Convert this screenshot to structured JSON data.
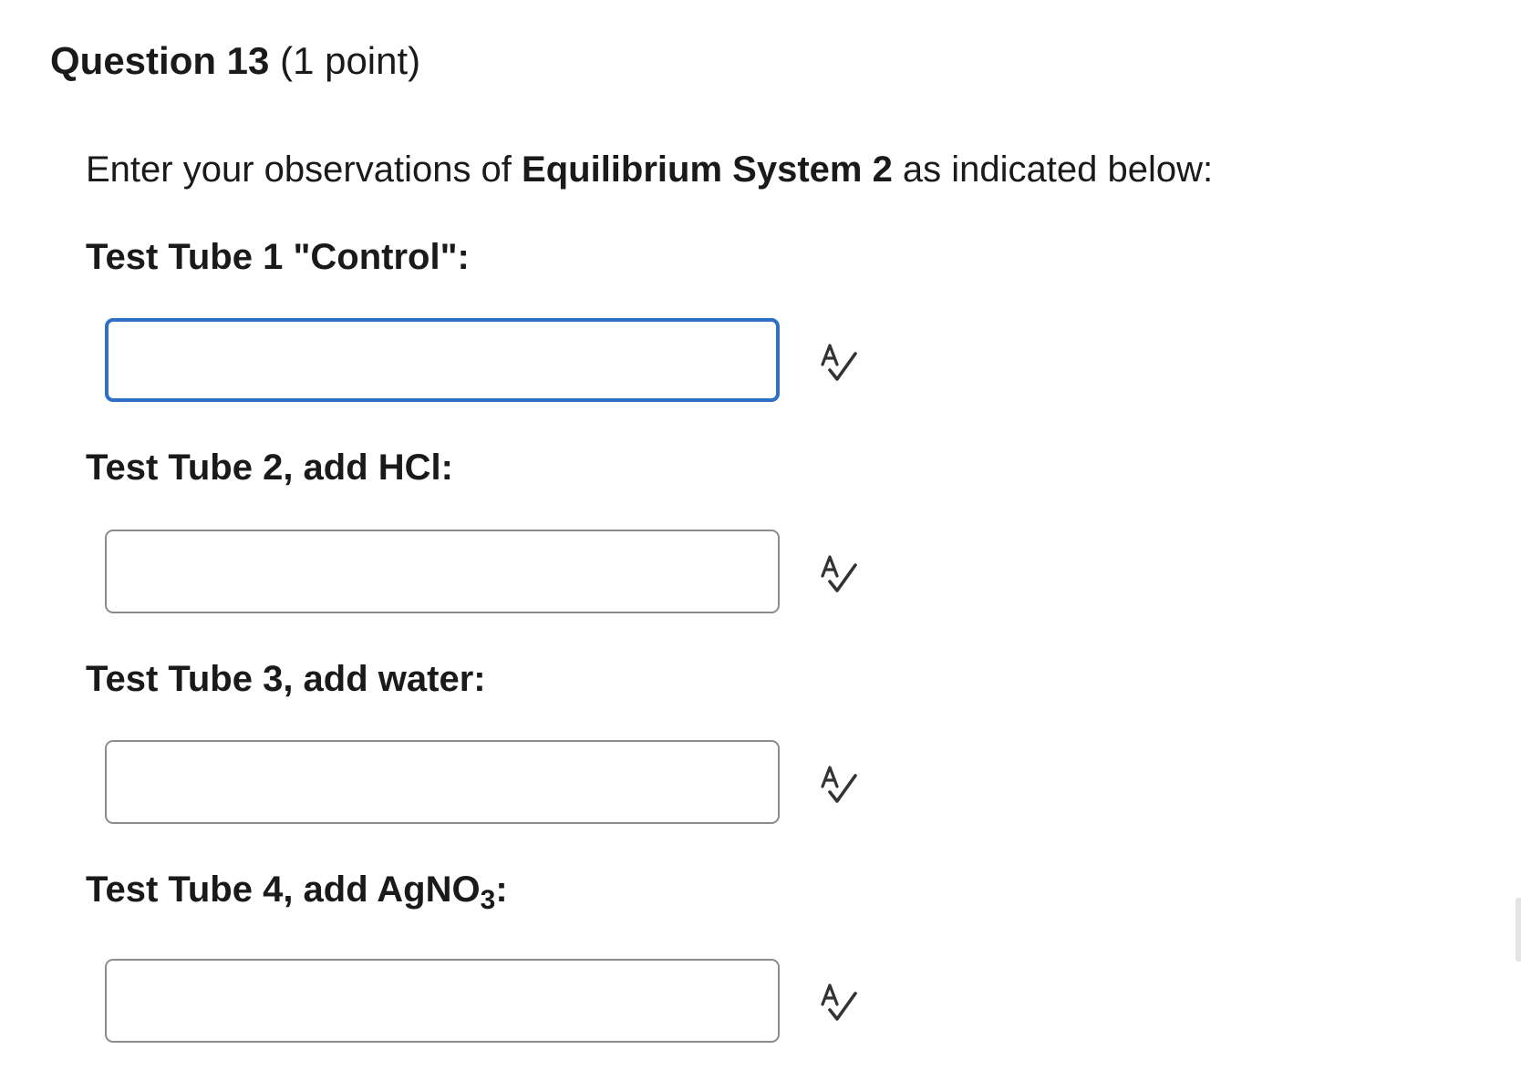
{
  "question": {
    "title": "Question 13",
    "points": "(1 point)"
  },
  "prompt": {
    "before": "Enter your observations of ",
    "emphasis": "Equilibrium System 2",
    "after": " as indicated below:"
  },
  "fields": [
    {
      "label": "Test Tube 1 \"Control\":",
      "value": "",
      "focused": true
    },
    {
      "label": "Test Tube 2, add HCl:",
      "value": ""
    },
    {
      "label": "Test Tube 3, add water:",
      "value": ""
    },
    {
      "label_main": "Test Tube 4, add AgNO",
      "label_sub": "3",
      "label_end": ":",
      "value": ""
    }
  ],
  "icons": {
    "spellcheck": "spellcheck-icon"
  },
  "colors": {
    "focus_border": "#2f6fc4",
    "input_border": "#8c8c8c",
    "text": "#1a1a1a",
    "icon": "#333333"
  }
}
